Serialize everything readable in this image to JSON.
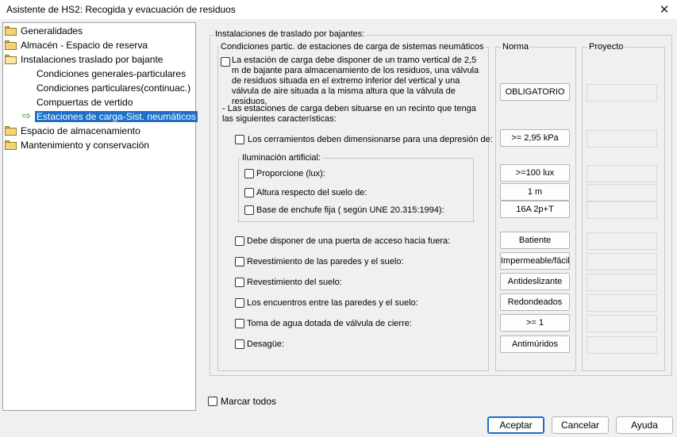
{
  "window": {
    "title": "Asistente de HS2: Recogida y evacuación de residuos",
    "close_glyph": "✕"
  },
  "tree": {
    "items": [
      {
        "label": "Generalidades",
        "icon": "folder-icon"
      },
      {
        "label": "Almacén - Espacio de reserva",
        "icon": "folder-icon"
      },
      {
        "label": "Instalaciones traslado por bajante",
        "icon": "folder-open-icon"
      },
      {
        "label": "Condiciones generales-particulares",
        "icon": "none"
      },
      {
        "label": "Condiciones particulares(continuac.)",
        "icon": "none"
      },
      {
        "label": "Compuertas de vertido",
        "icon": "none"
      },
      {
        "label": "Estaciones de carga-Sist. neumáticos",
        "icon": "arrow-icon",
        "selected": true
      },
      {
        "label": "Espacio de almacenamiento",
        "icon": "folder-icon"
      },
      {
        "label": "Mantenimiento y conservación",
        "icon": "folder-icon"
      }
    ],
    "arrow_glyph": "⇨"
  },
  "main": {
    "outer_title": "Instalaciones de traslado por bajantes:",
    "inner_title": "Condiciones partic. de estaciones de carga de sistemas neumáticos",
    "norma_title": "Norma",
    "proyecto_title": "Proyecto",
    "first_condition": "La estación de carga debe disponer de un tramo vertical de 2,5 m de bajante para almacenamiento de los residuos, una válvula de residuos situada en el extremo inferior del vertical y una válvula de aire situada a la misma altura que la válvula de residuos.",
    "first_norma": "OBLIGATORIO",
    "intro_text": "- Las estaciones de carga deben situarse en un recinto que tenga las siguientes características:",
    "cerramientos_label": "Los cerramientos deben dimensionarse para una depresión de:",
    "cerramientos_norma": ">= 2,95 kPa",
    "iluminacion_title": "Iluminación artificial:",
    "iluminacion_items": [
      {
        "label": "Proporcione (lux):",
        "norma": ">=100 lux"
      },
      {
        "label": "Altura respecto del suelo de:",
        "norma": "1 m"
      },
      {
        "label": "Base de enchufe fija ( según UNE 20.315:1994):",
        "norma": "16A 2p+T"
      }
    ],
    "conditions": [
      {
        "label": "Debe disponer de una puerta de acceso hacia fuera:",
        "norma": "Batiente"
      },
      {
        "label": "Revestimiento de las paredes y el suelo:",
        "norma": "Impermeable/fácil"
      },
      {
        "label": "Revestimiento del suelo:",
        "norma": "Antideslizante"
      },
      {
        "label": "Los encuentros entre las paredes y el suelo:",
        "norma": "Redondeados"
      },
      {
        "label": "Toma de agua dotada de válvula de cierre:",
        "norma": ">= 1"
      },
      {
        "label": "Desagüe:",
        "norma": "Antimúridos"
      }
    ]
  },
  "footer": {
    "mark_all": "Marcar todos",
    "accept": "Aceptar",
    "cancel": "Cancelar",
    "help": "Ayuda"
  },
  "colors": {
    "selection": "#1e6fc8",
    "arrow": "#3a8a2a",
    "folder": "#f4d27a"
  }
}
